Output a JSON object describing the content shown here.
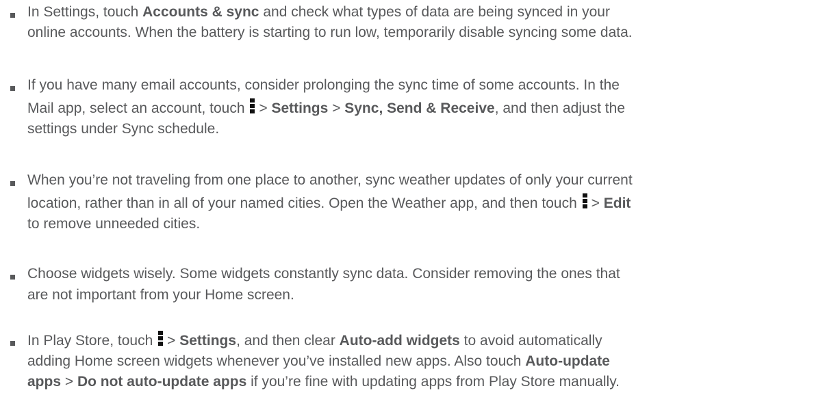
{
  "tips": [
    {
      "line1": {
        "t1": "In Settings, touch ",
        "b1": "Accounts & sync",
        "t2": " and check what types of data are being synced in your"
      },
      "line2": "online accounts. When the battery is starting to run low, temporarily disable syncing some data."
    },
    {
      "line1": "If you have many email accounts, consider prolonging the sync time of some accounts. In the",
      "line2": {
        "t1": "Mail app, select an account, touch ",
        "icon": "menu-icon",
        "t2": "> ",
        "b1": "Settings",
        "t3": " > ",
        "b2": "Sync, Send & Receive",
        "t4": ", and then adjust the"
      },
      "line3": "settings under Sync schedule."
    },
    {
      "line1": "When you’re not traveling from one place to another, sync weather updates of only your current",
      "line2": {
        "t1": "location, rather than in all of your named cities. Open the Weather app, and then touch ",
        "icon": "menu-icon",
        "t2": "> ",
        "b1": "Edit"
      },
      "line3": "to remove unneeded cities."
    },
    {
      "line1": "Choose widgets wisely. Some widgets constantly sync data. Consider removing the ones that",
      "line2": "are not important from your Home screen."
    },
    {
      "line1": {
        "t1": "In Play Store, touch ",
        "icon": "menu-icon",
        "t2": "> ",
        "b1": "Settings",
        "t3": ", and then clear ",
        "b2": "Auto-add widgets",
        "t4": " to avoid automatically"
      },
      "line2": {
        "t1": "adding Home screen widgets whenever you’ve installed new apps. Also touch ",
        "b1": "Auto-update"
      },
      "line3": {
        "b1": "apps",
        "t1": " > ",
        "b2": "Do not auto-update apps",
        "t2": " if you’re fine with updating apps from Play Store manually."
      }
    }
  ]
}
